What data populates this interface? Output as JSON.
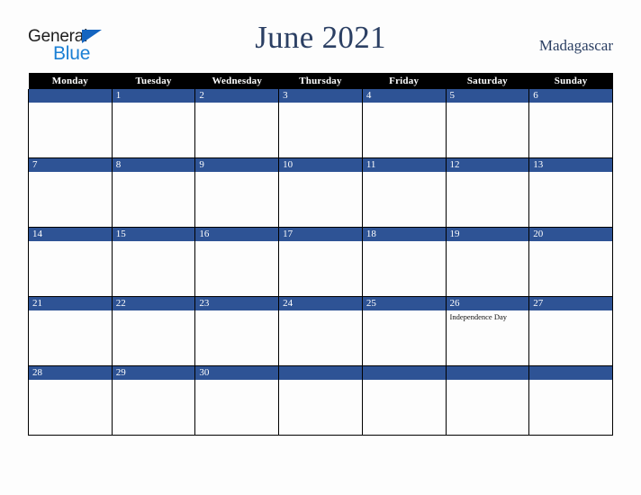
{
  "brand": {
    "line1": "General",
    "line2": "Blue",
    "triangle_color": "#1565c0",
    "line2_color": "#1a7fd4"
  },
  "header": {
    "title": "June 2021",
    "region": "Madagascar",
    "title_color": "#2b3f63"
  },
  "calendar": {
    "header_bg": "#000000",
    "header_fg": "#ffffff",
    "daybar_bg": "#2e5395",
    "daybar_fg": "#ffffff",
    "cell_bg": "#fdfdfd",
    "weekdays": [
      "Monday",
      "Tuesday",
      "Wednesday",
      "Thursday",
      "Friday",
      "Saturday",
      "Sunday"
    ],
    "weeks": [
      [
        {
          "date": "",
          "events": []
        },
        {
          "date": "1",
          "events": []
        },
        {
          "date": "2",
          "events": []
        },
        {
          "date": "3",
          "events": []
        },
        {
          "date": "4",
          "events": []
        },
        {
          "date": "5",
          "events": []
        },
        {
          "date": "6",
          "events": []
        }
      ],
      [
        {
          "date": "7",
          "events": []
        },
        {
          "date": "8",
          "events": []
        },
        {
          "date": "9",
          "events": []
        },
        {
          "date": "10",
          "events": []
        },
        {
          "date": "11",
          "events": []
        },
        {
          "date": "12",
          "events": []
        },
        {
          "date": "13",
          "events": []
        }
      ],
      [
        {
          "date": "14",
          "events": []
        },
        {
          "date": "15",
          "events": []
        },
        {
          "date": "16",
          "events": []
        },
        {
          "date": "17",
          "events": []
        },
        {
          "date": "18",
          "events": []
        },
        {
          "date": "19",
          "events": []
        },
        {
          "date": "20",
          "events": []
        }
      ],
      [
        {
          "date": "21",
          "events": []
        },
        {
          "date": "22",
          "events": []
        },
        {
          "date": "23",
          "events": []
        },
        {
          "date": "24",
          "events": []
        },
        {
          "date": "25",
          "events": []
        },
        {
          "date": "26",
          "events": [
            "Independence Day"
          ]
        },
        {
          "date": "27",
          "events": []
        }
      ],
      [
        {
          "date": "28",
          "events": []
        },
        {
          "date": "29",
          "events": []
        },
        {
          "date": "30",
          "events": []
        },
        {
          "date": "",
          "events": []
        },
        {
          "date": "",
          "events": []
        },
        {
          "date": "",
          "events": []
        },
        {
          "date": "",
          "events": []
        }
      ]
    ]
  }
}
